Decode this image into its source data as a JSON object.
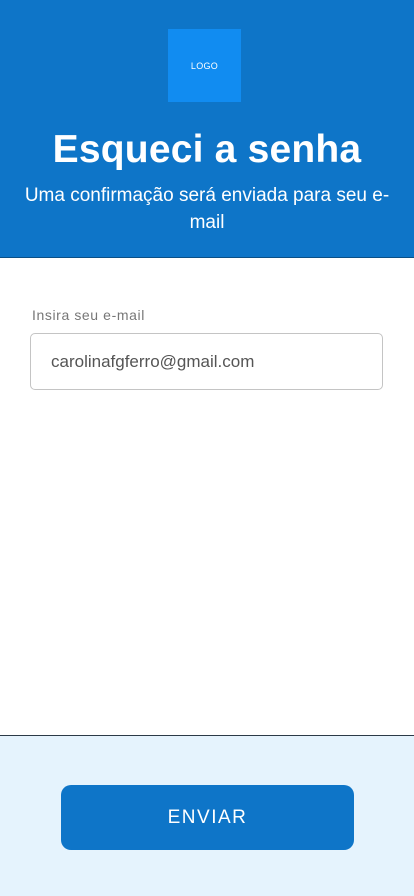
{
  "header": {
    "logo_text": "LOGO",
    "title": "Esqueci a senha",
    "subtitle": "Uma confirmação será enviada para seu e-mail"
  },
  "form": {
    "email_label": "Insira seu e-mail",
    "email_value": "carolinafgferro@gmail.com"
  },
  "footer": {
    "submit_label": "ENVIAR"
  },
  "colors": {
    "primary": "#0e75c8",
    "logo_bg": "#118cf1",
    "footer_bg": "#e5f3fd",
    "input_border": "#c4c4c4"
  }
}
